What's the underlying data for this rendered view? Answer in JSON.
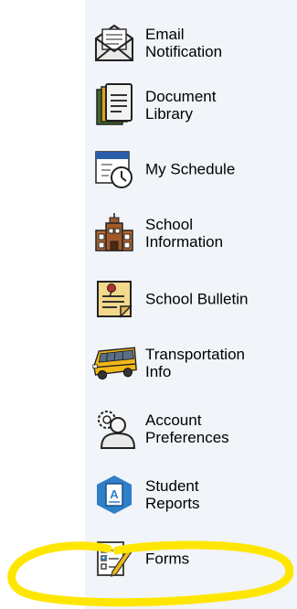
{
  "menu": {
    "items": [
      {
        "label": "Email\nNotification",
        "icon": "envelope-icon"
      },
      {
        "label": "Document\nLibrary",
        "icon": "document-icon"
      },
      {
        "label": "My Schedule",
        "icon": "calendar-clock-icon"
      },
      {
        "label": "School\nInformation",
        "icon": "school-building-icon"
      },
      {
        "label": "School Bulletin",
        "icon": "bulletin-pin-icon"
      },
      {
        "label": "Transportation\nInfo",
        "icon": "school-bus-icon"
      },
      {
        "label": "Account\nPreferences",
        "icon": "user-gear-icon"
      },
      {
        "label": "Student\nReports",
        "icon": "student-report-icon"
      },
      {
        "label": "Forms",
        "icon": "form-checklist-icon"
      }
    ]
  },
  "colors": {
    "panel": "#f1f4f8",
    "highlight": "#ffe600",
    "text": "#000000"
  }
}
